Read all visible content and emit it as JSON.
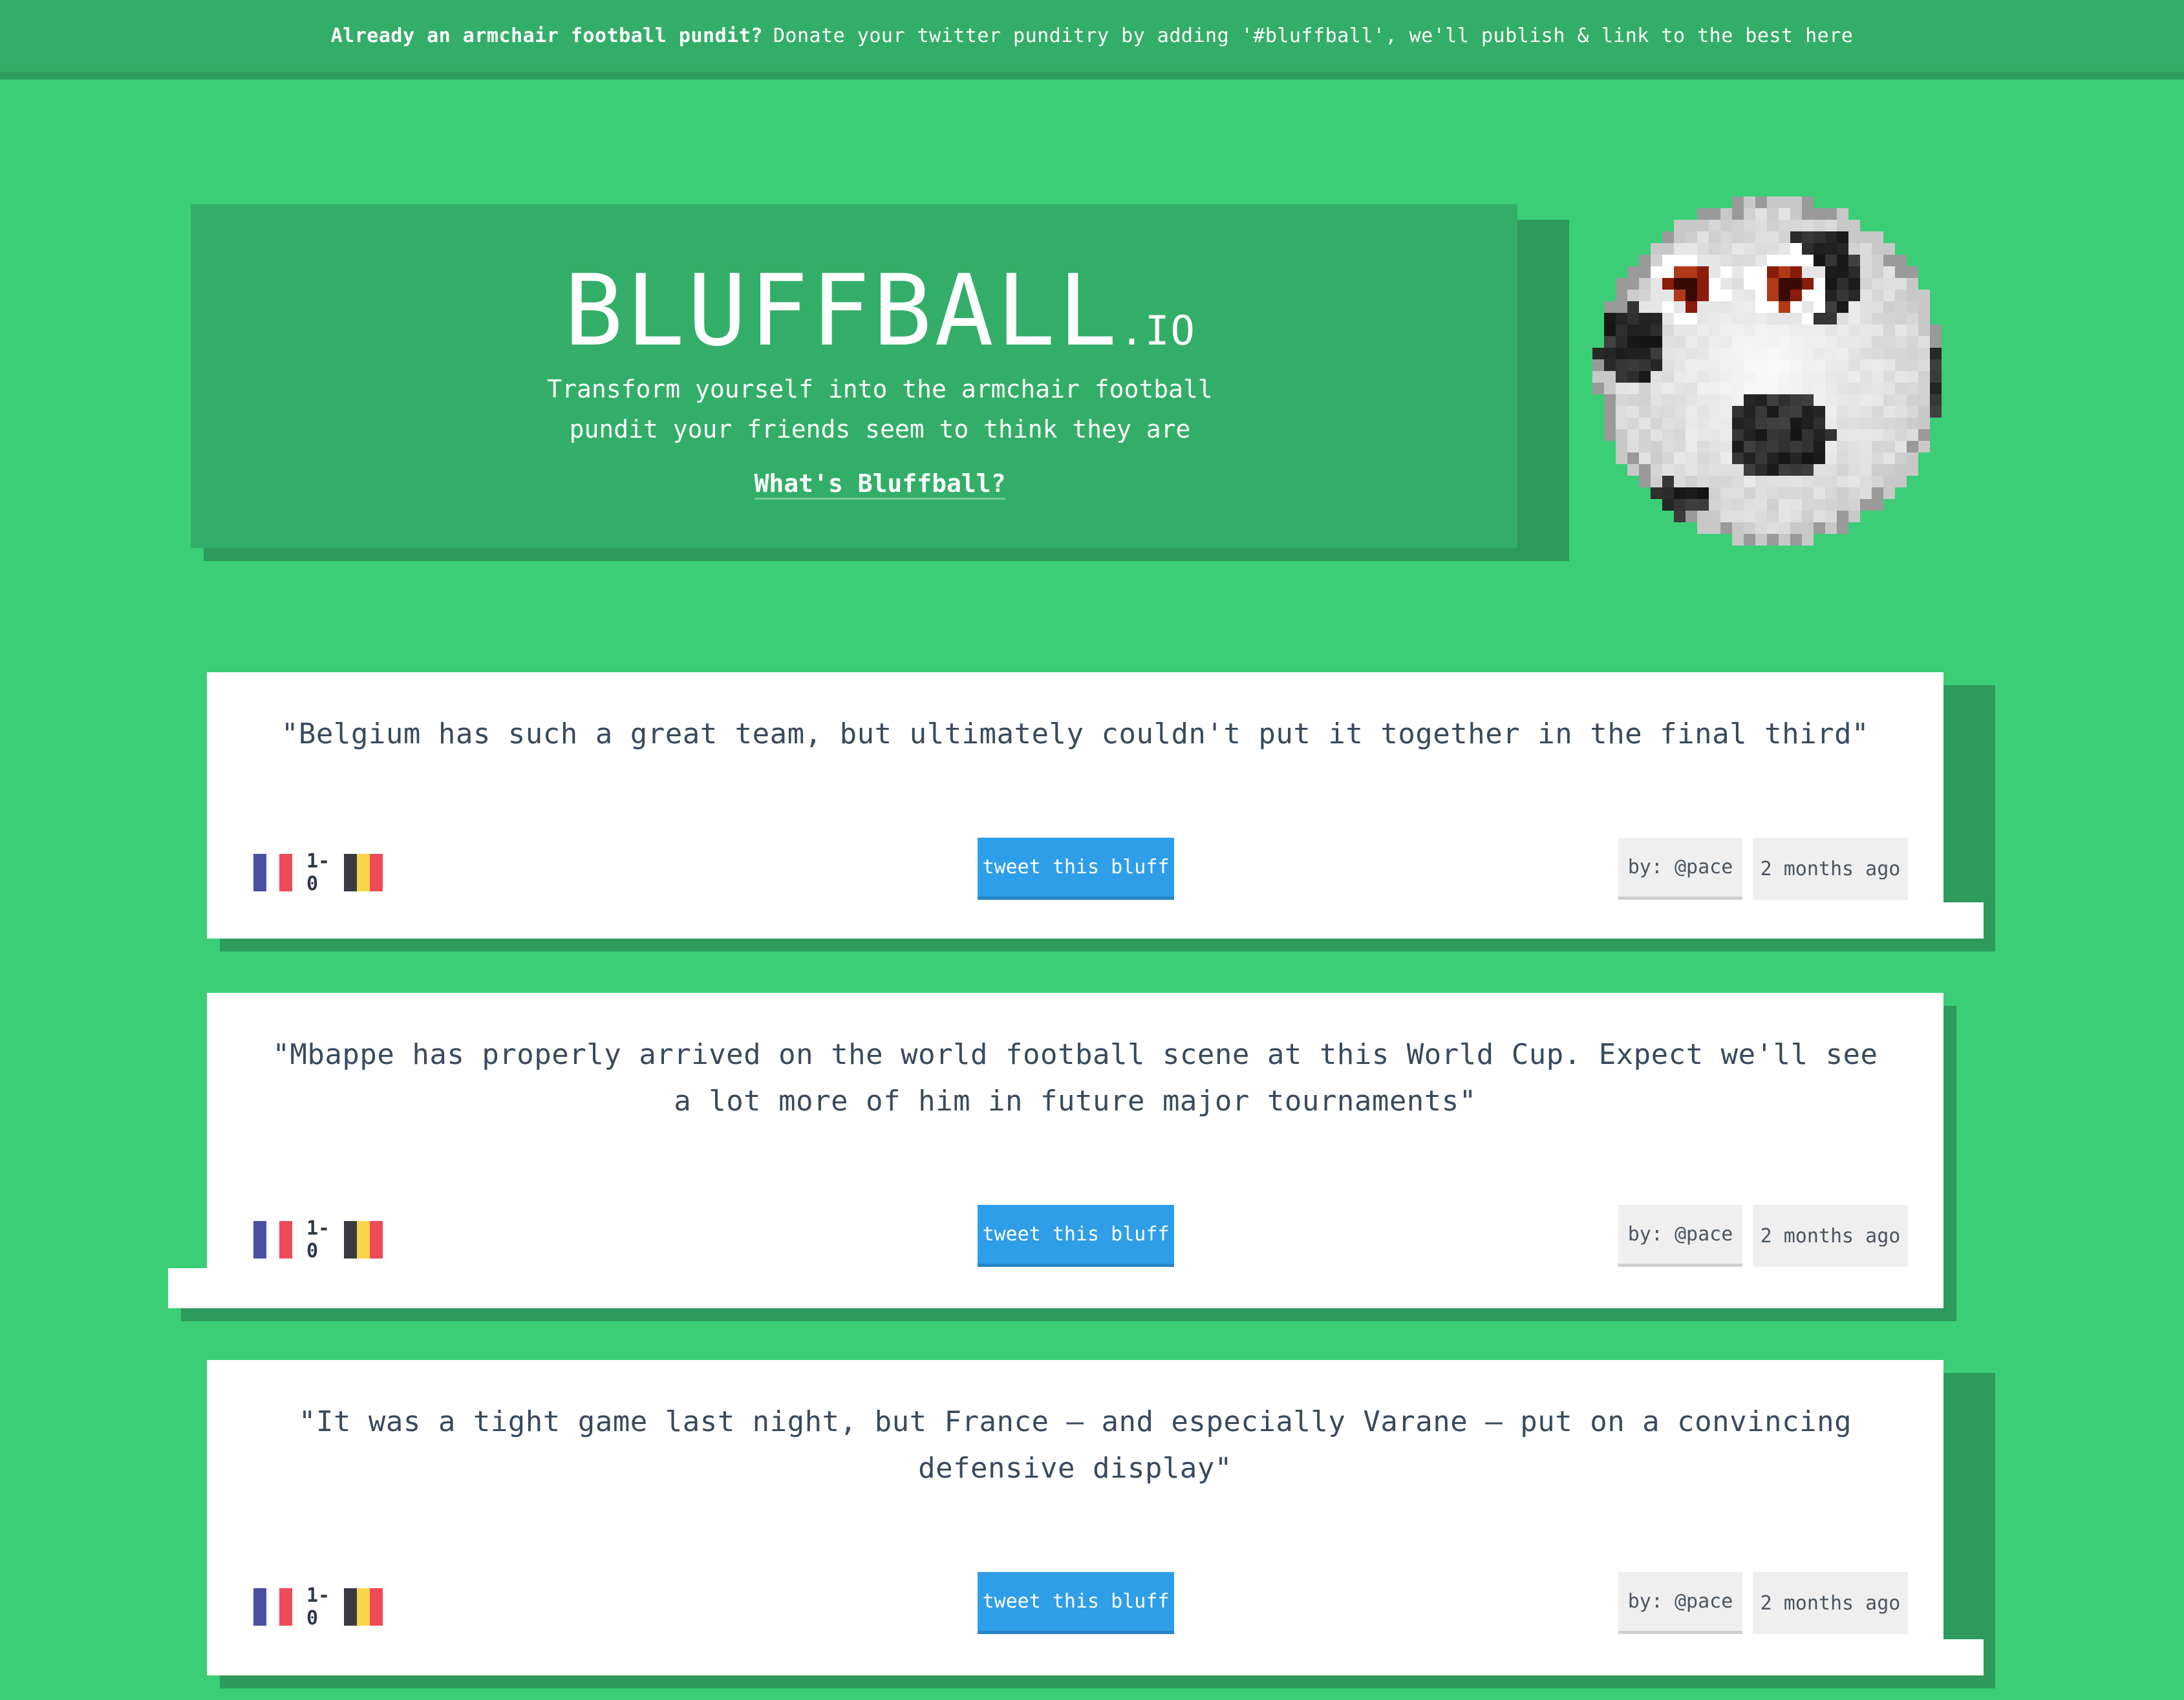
{
  "banner": {
    "lead": "Already an armchair football pundit?",
    "text": "Donate your twitter punditry by adding '#bluffball', we'll publish & link to the best here"
  },
  "hero": {
    "title": "BLUFFBALL",
    "tld": ".IO",
    "tagline_line1": "Transform yourself into the armchair football",
    "tagline_line2": "pundit your friends seem to think they are",
    "link": "What's Bluffball?"
  },
  "bluffs": [
    {
      "quote": "\"Belgium has such a great team, but ultimately couldn't put it together in the final third\"",
      "score": "1-0",
      "tweet_label": "tweet this bluff",
      "author": "by: @pace",
      "time": "2 months ago"
    },
    {
      "quote": "\"Mbappe has properly arrived on the world football scene at this World Cup. Expect we'll see a lot more of him in future major tournaments\"",
      "score": "1-0",
      "tweet_label": "tweet this bluff",
      "author": "by: @pace",
      "time": "2 months ago"
    },
    {
      "quote": "\"It was a tight game last night, but France – and especially Varane – put on a convincing defensive display\"",
      "score": "1-0",
      "tweet_label": "tweet this bluff",
      "author": "by: @pace",
      "time": "2 months ago"
    }
  ],
  "colors": {
    "background": "#3bce76",
    "dark_green": "#33ae68",
    "shadow_green": "#2e9a5b",
    "tweet_blue": "#2f9ee8",
    "france": [
      "#4a4fa3",
      "#ffffff",
      "#ef4a5a"
    ],
    "belgium": [
      "#3a3a44",
      "#f7d54a",
      "#ef4a5a"
    ]
  }
}
